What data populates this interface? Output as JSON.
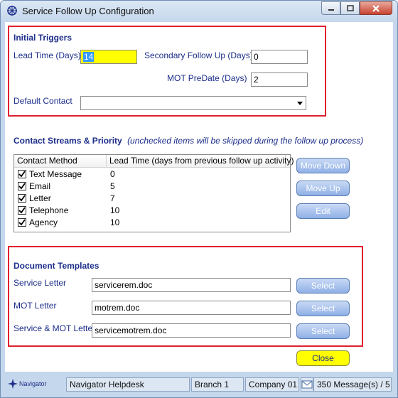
{
  "window": {
    "title": "Service Follow Up Configuration"
  },
  "initial_triggers": {
    "heading": "Initial Triggers",
    "lead_time_label": "Lead Time (Days)",
    "lead_time_value": "14",
    "secondary_label": "Secondary Follow Up (Days)",
    "secondary_value": "0",
    "mot_label": "MOT PreDate (Days)",
    "mot_value": "2",
    "default_contact_label": "Default Contact",
    "default_contact_value": ""
  },
  "contact_streams": {
    "heading": "Contact Streams & Priority",
    "hint": "(unchecked items will be skipped during the follow up process)",
    "columns": [
      "Contact Method",
      "Lead Time (days from previous follow up activity)"
    ],
    "rows": [
      {
        "method": "Text Message",
        "lead": "0",
        "checked": true
      },
      {
        "method": "Email",
        "lead": "5",
        "checked": true
      },
      {
        "method": "Letter",
        "lead": "7",
        "checked": true
      },
      {
        "method": "Telephone",
        "lead": "10",
        "checked": true
      },
      {
        "method": "Agency",
        "lead": "10",
        "checked": true
      }
    ],
    "move_down_label": "Move Down",
    "move_up_label": "Move Up",
    "edit_label": "Edit"
  },
  "document_templates": {
    "heading": "Document Templates",
    "service_letter_label": "Service Letter",
    "service_letter_value": "servicerem.doc",
    "mot_letter_label": "MOT Letter",
    "mot_letter_value": "motrem.doc",
    "service_mot_label": "Service & MOT Letter",
    "service_mot_value": "servicemotrem.doc",
    "select_label": "Select"
  },
  "close_label": "Close",
  "status_bar": {
    "logo_text": "Navigator",
    "helpdesk": "Navigator Helpdesk",
    "branch": "Branch 1",
    "company": "Company 01",
    "messages": "350 Message(s) / 5"
  },
  "colors": {
    "accent_label": "#1c2d8a",
    "highlight_box": "#e0202f",
    "required_field": "#ffff00",
    "button_blue": "#8fb0e6"
  }
}
